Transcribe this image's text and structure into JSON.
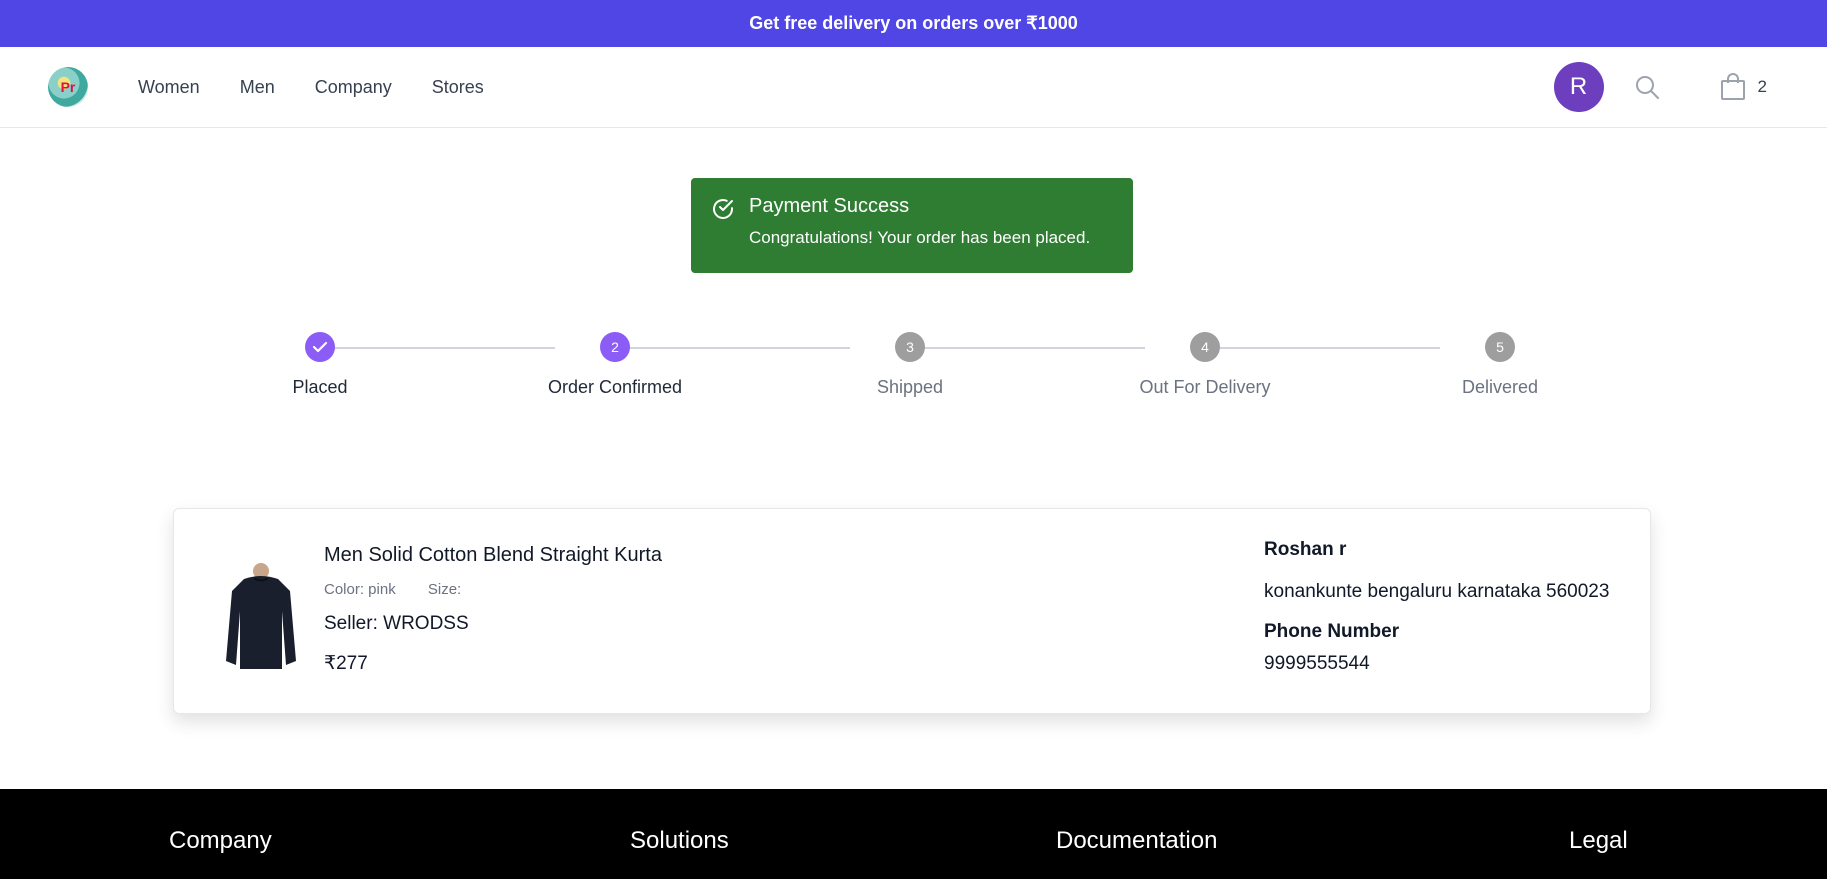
{
  "promo": {
    "text": "Get free delivery on orders over ₹1000"
  },
  "header": {
    "logo_text": "Pr",
    "nav": [
      {
        "label": "Women"
      },
      {
        "label": "Men"
      },
      {
        "label": "Company"
      },
      {
        "label": "Stores"
      }
    ],
    "avatar_letter": "R",
    "cart_count": "2",
    "icons": [
      "search-icon",
      "shopping-bag-icon"
    ]
  },
  "toast": {
    "icon": "check-circle-icon",
    "title": "Payment Success",
    "message": "Congratulations! Your order has been placed.",
    "color": "#2e7d32"
  },
  "stepper": {
    "current_step": 2,
    "steps": [
      {
        "label": "Placed",
        "marker": "✓",
        "status": "completed"
      },
      {
        "label": "Order Confirmed",
        "marker": "2",
        "status": "active"
      },
      {
        "label": "Shipped",
        "marker": "3",
        "status": "pending"
      },
      {
        "label": "Out For Delivery",
        "marker": "4",
        "status": "pending"
      },
      {
        "label": "Delivered",
        "marker": "5",
        "status": "pending"
      }
    ],
    "active_color": "#8b5cf6",
    "pending_color": "#9e9e9e"
  },
  "order": {
    "product_name": "Men Solid Cotton Blend Straight Kurta",
    "color_label": "Color: pink",
    "size_label": "Size:",
    "seller": "Seller: WRODSS",
    "price": "₹277",
    "customer_name": "Roshan r",
    "address": "konankunte bengaluru karnataka 560023",
    "phone_label": "Phone Number",
    "phone": "9999555544"
  },
  "footer": {
    "headings": [
      "Company",
      "Solutions",
      "Documentation",
      "Legal"
    ]
  },
  "colors": {
    "brand": "#4f46e5",
    "avatar": "#6d3fbf",
    "footer": "#000000"
  }
}
